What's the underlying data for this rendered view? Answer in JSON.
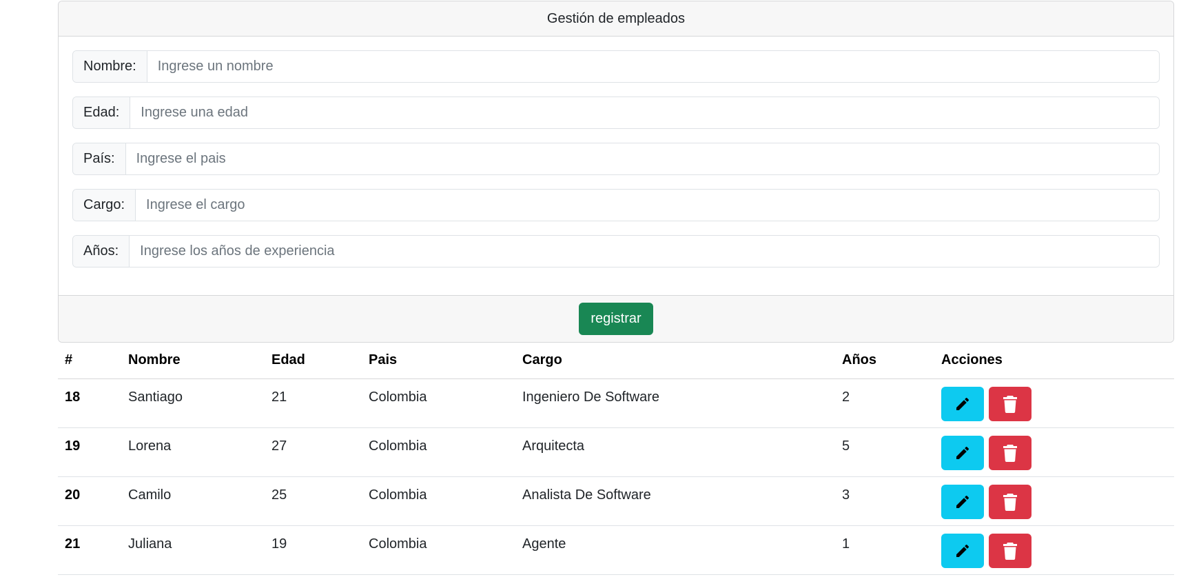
{
  "form": {
    "title": "Gestión de empleados",
    "fields": [
      {
        "label": "Nombre:",
        "placeholder": "Ingrese un nombre",
        "value": ""
      },
      {
        "label": "Edad:",
        "placeholder": "Ingrese una edad",
        "value": ""
      },
      {
        "label": "País:",
        "placeholder": "Ingrese el pais",
        "value": ""
      },
      {
        "label": "Cargo:",
        "placeholder": "Ingrese el cargo",
        "value": ""
      },
      {
        "label": "Años:",
        "placeholder": "Ingrese los años de experiencia",
        "value": ""
      }
    ],
    "submit_label": "registrar"
  },
  "table": {
    "columns": [
      "#",
      "Nombre",
      "Edad",
      "Pais",
      "Cargo",
      "Años",
      "Acciones"
    ],
    "rows": [
      {
        "id": "18",
        "nombre": "Santiago",
        "edad": "21",
        "pais": "Colombia",
        "cargo": "Ingeniero De Software",
        "anios": "2"
      },
      {
        "id": "19",
        "nombre": "Lorena",
        "edad": "27",
        "pais": "Colombia",
        "cargo": "Arquitecta",
        "anios": "5"
      },
      {
        "id": "20",
        "nombre": "Camilo",
        "edad": "25",
        "pais": "Colombia",
        "cargo": "Analista De Software",
        "anios": "3"
      },
      {
        "id": "21",
        "nombre": "Juliana",
        "edad": "19",
        "pais": "Colombia",
        "cargo": "Agente",
        "anios": "1"
      }
    ],
    "actions": {
      "edit_icon": "pencil-icon",
      "delete_icon": "trash-icon"
    }
  },
  "colors": {
    "register": "#198754",
    "edit": "#0dcaf0",
    "delete": "#dc3545"
  }
}
